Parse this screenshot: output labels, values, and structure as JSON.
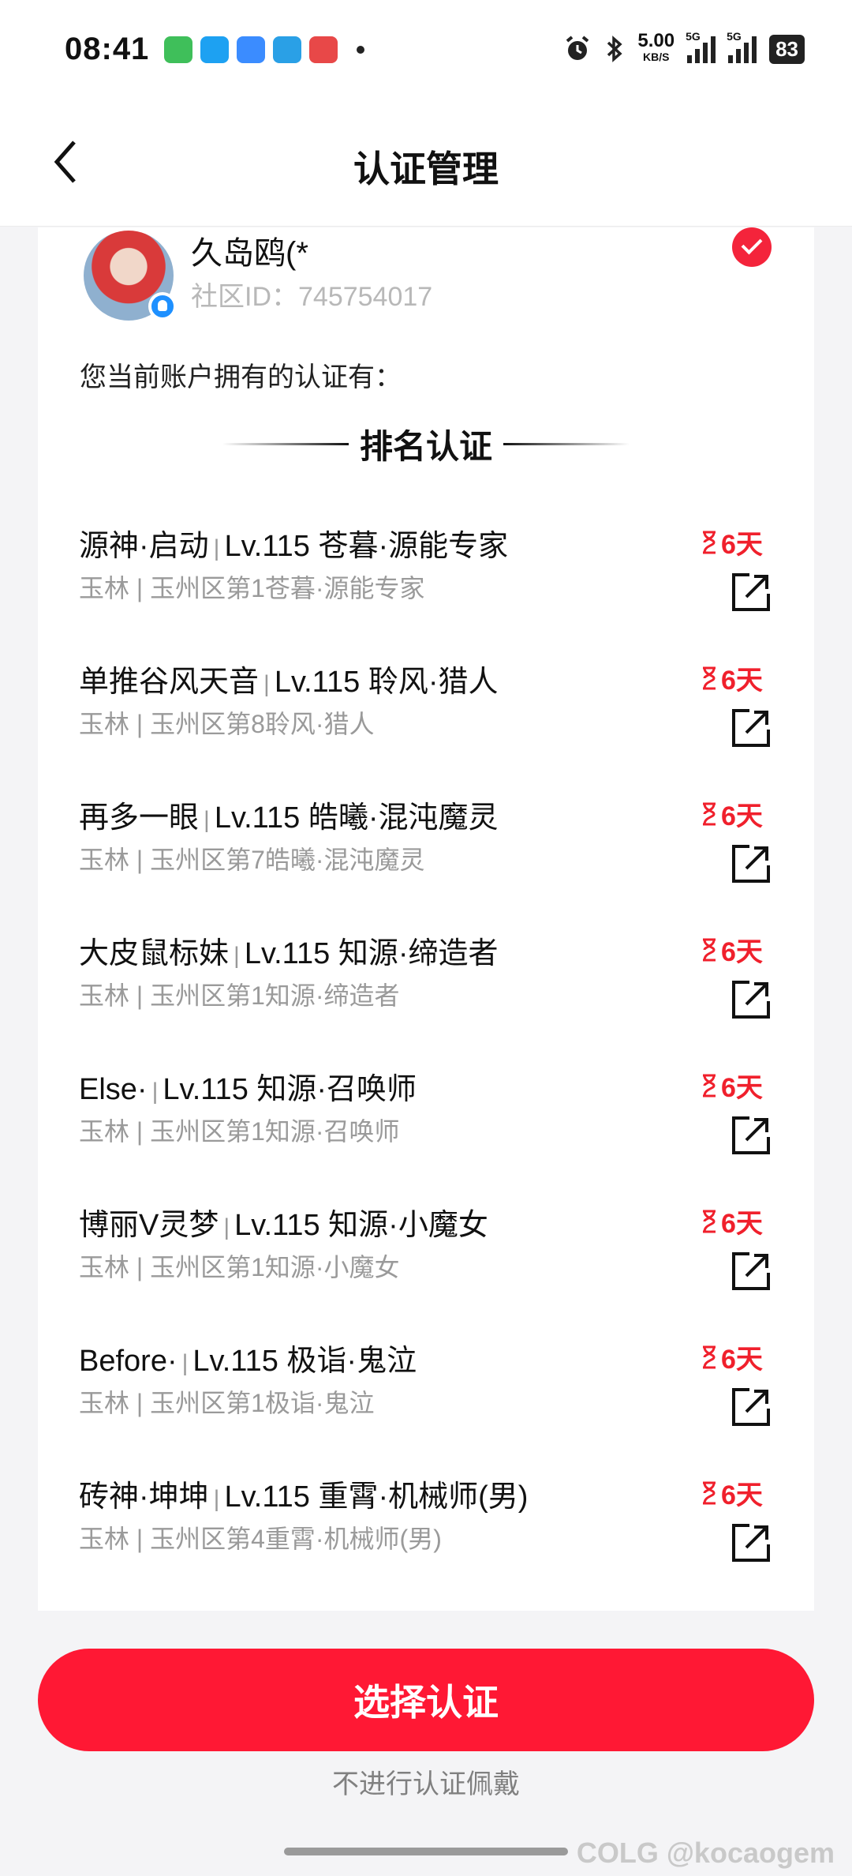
{
  "status_bar": {
    "time": "08:41",
    "net_speed": "5.00",
    "net_unit": "KB/S",
    "signal1_label": "5G",
    "signal2_label": "5G",
    "battery": "83",
    "app_icon_colors": [
      "#3fbf5a",
      "#1da1f2",
      "#3b8cff",
      "#2aa0e6",
      "#e84848"
    ]
  },
  "header": {
    "back_icon": "chevron-left-icon",
    "title": "认证管理"
  },
  "profile": {
    "username": "久岛鸥(*",
    "community_id": "社区ID：745754017",
    "selected": true
  },
  "own_text": "您当前账户拥有的认证有：",
  "section_title": "排名认证",
  "certs": [
    {
      "name": "源神·启动",
      "level": "Lv.115 苍暮·源能专家",
      "sub": "玉林 | 玉州区第1苍暮·源能专家",
      "days": "6天"
    },
    {
      "name": "单推谷风天音",
      "level": "Lv.115 聆风·猎人",
      "sub": "玉林 | 玉州区第8聆风·猎人",
      "days": "6天"
    },
    {
      "name": "再多一眼",
      "level": "Lv.115 皓曦·混沌魔灵",
      "sub": "玉林 | 玉州区第7皓曦·混沌魔灵",
      "days": "6天"
    },
    {
      "name": "大皮鼠标妹",
      "level": "Lv.115 知源·缔造者",
      "sub": "玉林 | 玉州区第1知源·缔造者",
      "days": "6天"
    },
    {
      "name": "Else·",
      "level": "Lv.115 知源·召唤师",
      "sub": "玉林 | 玉州区第1知源·召唤师",
      "days": "6天"
    },
    {
      "name": "博丽V灵梦",
      "level": "Lv.115 知源·小魔女",
      "sub": "玉林 | 玉州区第1知源·小魔女",
      "days": "6天"
    },
    {
      "name": "Before·",
      "level": "Lv.115 极诣·鬼泣",
      "sub": "玉林 | 玉州区第1极诣·鬼泣",
      "days": "6天"
    },
    {
      "name": "砖神·坤坤",
      "level": "Lv.115 重霄·机械师(男)",
      "sub": "玉林 | 玉州区第4重霄·机械师(男)",
      "days": "6天"
    }
  ],
  "separator": "|",
  "primary_button": "选择认证",
  "secondary_link": "不进行认证佩戴",
  "watermark": "COLG @kocaogem",
  "colors": {
    "accent": "#ff1834",
    "days_red": "#f0202c"
  }
}
